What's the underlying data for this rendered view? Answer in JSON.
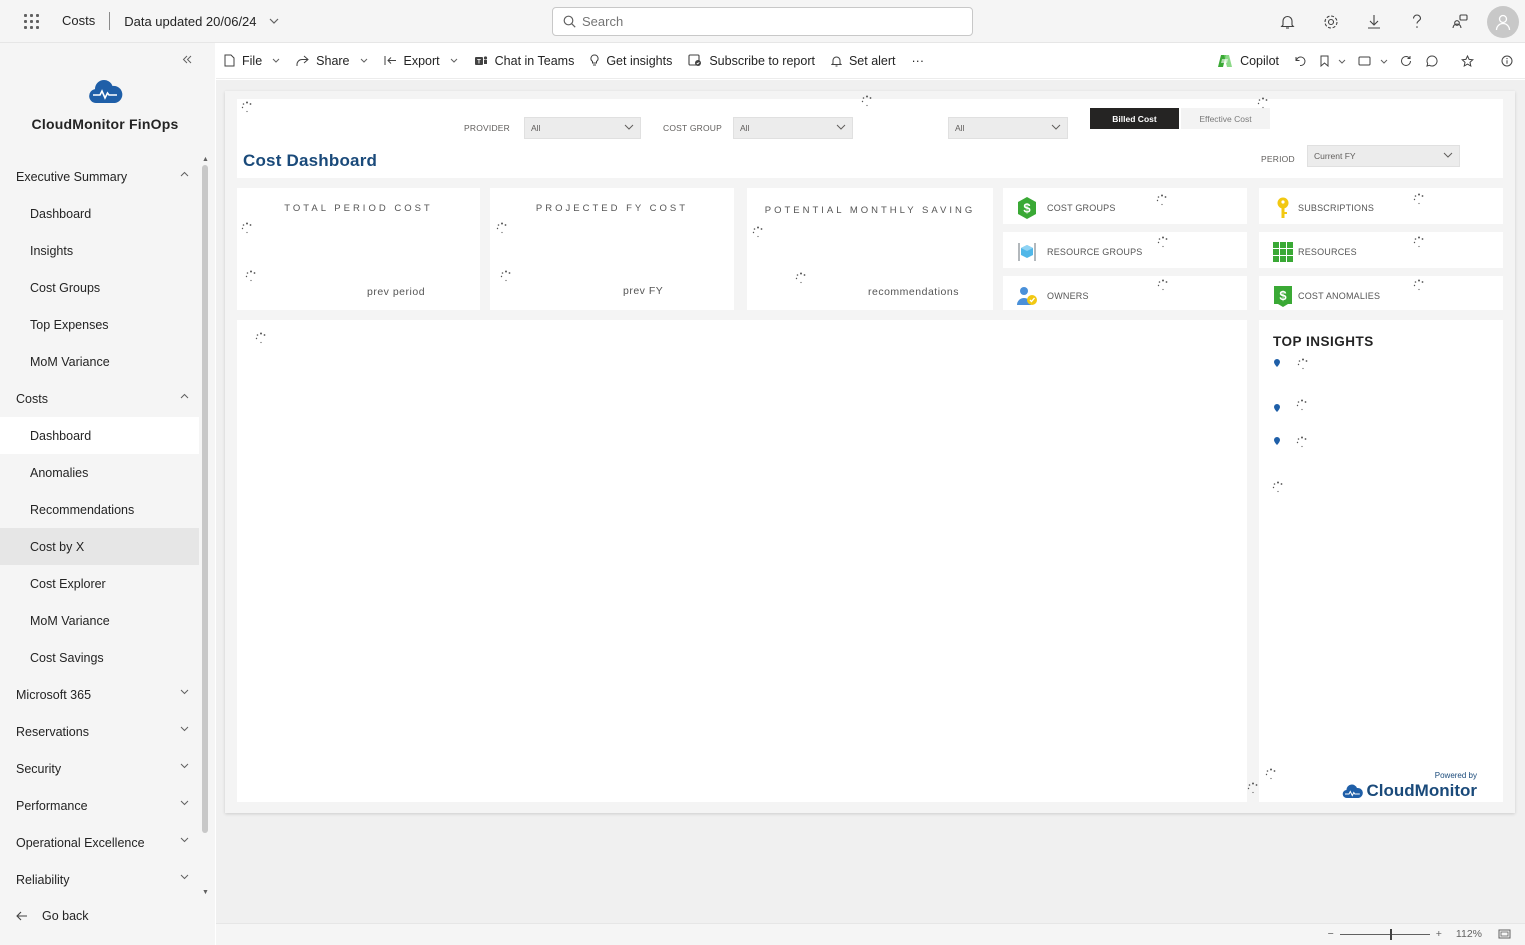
{
  "topbar": {
    "app_name": "Costs",
    "data_updated": "Data updated 20/06/24",
    "search_placeholder": "Search"
  },
  "sidebar": {
    "brand": "CloudMonitor FinOps",
    "items": [
      {
        "label": "Executive Summary",
        "type": "section",
        "expanded": true
      },
      {
        "label": "Dashboard",
        "type": "child"
      },
      {
        "label": "Insights",
        "type": "child"
      },
      {
        "label": "Cost Groups",
        "type": "child"
      },
      {
        "label": "Top Expenses",
        "type": "child"
      },
      {
        "label": "MoM Variance",
        "type": "child"
      },
      {
        "label": "Costs",
        "type": "section",
        "expanded": true
      },
      {
        "label": "Dashboard",
        "type": "child",
        "state": "active"
      },
      {
        "label": "Anomalies",
        "type": "child"
      },
      {
        "label": "Recommendations",
        "type": "child"
      },
      {
        "label": "Cost by X",
        "type": "child",
        "state": "hover"
      },
      {
        "label": "Cost Explorer",
        "type": "child"
      },
      {
        "label": "MoM Variance",
        "type": "child"
      },
      {
        "label": "Cost Savings",
        "type": "child"
      },
      {
        "label": "Microsoft 365",
        "type": "section",
        "expanded": false
      },
      {
        "label": "Reservations",
        "type": "section",
        "expanded": false
      },
      {
        "label": "Security",
        "type": "section",
        "expanded": false
      },
      {
        "label": "Performance",
        "type": "section",
        "expanded": false
      },
      {
        "label": "Operational Excellence",
        "type": "section",
        "expanded": false
      },
      {
        "label": "Reliability",
        "type": "section",
        "expanded": false
      }
    ],
    "go_back": "Go back"
  },
  "toolbar": {
    "file": "File",
    "share": "Share",
    "export": "Export",
    "chat_in_teams": "Chat in Teams",
    "get_insights": "Get insights",
    "subscribe": "Subscribe to report",
    "set_alert": "Set alert",
    "more": "···",
    "copilot": "Copilot"
  },
  "report": {
    "title": "Cost Dashboard",
    "filters": {
      "provider_label": "PROVIDER",
      "provider_value": "All",
      "cost_group_label": "COST GROUP",
      "cost_group_value": "All",
      "third_value": "All",
      "billed_cost": "Billed Cost",
      "effective_cost": "Effective Cost",
      "period_label": "PERIOD",
      "period_value": "Current FY"
    },
    "kpis": [
      {
        "title": "TOTAL PERIOD COST",
        "sub": "prev period"
      },
      {
        "title": "PROJECTED FY COST",
        "sub": "prev FY"
      },
      {
        "title": "POTENTIAL MONTHLY SAVING",
        "sub": "recommendations"
      }
    ],
    "tiles": [
      {
        "label": "COST GROUPS",
        "icon": "dollar-icon"
      },
      {
        "label": "SUBSCRIPTIONS",
        "icon": "key-icon"
      },
      {
        "label": "RESOURCE GROUPS",
        "icon": "cube-icon"
      },
      {
        "label": "RESOURCES",
        "icon": "grid-icon"
      },
      {
        "label": "OWNERS",
        "icon": "people-icon"
      },
      {
        "label": "COST ANOMALIES",
        "icon": "dollar-icon"
      }
    ],
    "insights_title": "TOP INSIGHTS",
    "powered_by": "Powered by",
    "powered_brand": "CloudMonitor"
  },
  "statusbar": {
    "zoom_level": "112%"
  },
  "colors": {
    "brand_blue": "#1a4a7a",
    "accent_green": "#3aa935",
    "billed_button": "#252423"
  }
}
